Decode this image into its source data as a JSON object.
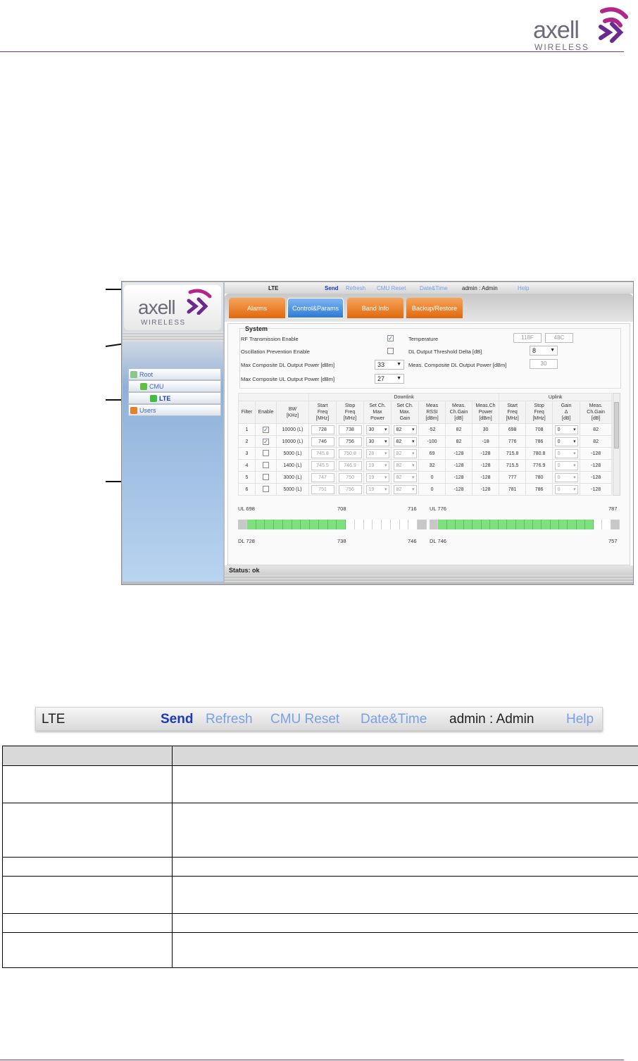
{
  "page": {
    "brand_word": "axell",
    "brand_sub": "WIRELESS",
    "accent_color": "#9a2a6f"
  },
  "screenshot": {
    "topbar": {
      "title": "LTE",
      "send": "Send",
      "refresh": "Refresh",
      "cmu_reset": "CMU Reset",
      "date_time": "Date&Time",
      "user": "admin : Admin",
      "help": "Help"
    },
    "tabs": [
      {
        "label": "Alarms",
        "active": false
      },
      {
        "label": "Control&Params",
        "active": true
      },
      {
        "label": "Band Info",
        "active": false
      },
      {
        "label": "Backup/Restore",
        "active": false
      }
    ],
    "tree": {
      "root": "Root",
      "cmu": "CMU",
      "lte": "LTE",
      "users": "Users"
    },
    "system": {
      "title": "System",
      "rf_enable_label": "RF Transmission Enable",
      "rf_enable_checked": true,
      "osc_label": "Oscillation Prevention Enable",
      "osc_checked": false,
      "max_dl_label": "Max Composite DL Output Power [dBm]",
      "max_dl_value": "33",
      "max_ul_label": "Max Composite UL Output Power [dBm]",
      "max_ul_value": "27",
      "temp_label": "Temperature",
      "temp_f": "118F",
      "temp_c": "48C",
      "dl_thresh_label": "DL Output Threshold Delta [dB]",
      "dl_thresh_value": "8",
      "meas_dl_label": "Meas. Composite DL Output Power [dBm]",
      "meas_dl_value": "30"
    },
    "grid": {
      "group_downlink": "Downlink",
      "group_uplink": "Uplink",
      "headers": {
        "filter": "Filter",
        "enable": "Enable",
        "bw": [
          "BW",
          "[KHz]"
        ],
        "dl_start": [
          "Start",
          "Freq",
          "[MHz]"
        ],
        "dl_stop": [
          "Stop",
          "Freq",
          "[MHz]"
        ],
        "dl_setpow": [
          "Set Ch.",
          "Max",
          "Power"
        ],
        "dl_setgain": [
          "Set Ch.",
          "Max.",
          "Gain"
        ],
        "dl_rssi": [
          "Meas",
          "RSSI",
          "[dBm]"
        ],
        "dl_chgain": [
          "Meas.",
          "Ch.Gain",
          "[dB]"
        ],
        "dl_chpower": [
          "Meas.Ch",
          "Power",
          "[dBm]"
        ],
        "ul_start": [
          "Start",
          "Freq",
          "[MHz]"
        ],
        "ul_stop": [
          "Stop",
          "Freq",
          "[MHz]"
        ],
        "ul_gaindelta": [
          "Gain",
          "Δ",
          "[dB]"
        ],
        "ul_chgain": [
          "Meas.",
          "Ch.Gain",
          "[dB]"
        ]
      },
      "rows": [
        {
          "filter": "1",
          "enabled": true,
          "bw": "10000 (L)",
          "dl_start": "728",
          "dl_stop": "738",
          "dl_pow": "30",
          "dl_gain": "82",
          "rssi": "-52",
          "chgain": "82",
          "chpow": "30",
          "ul_start": "698",
          "ul_stop": "708",
          "ul_gd": "0",
          "ul_chgain": "82"
        },
        {
          "filter": "2",
          "enabled": true,
          "bw": "10000 (L)",
          "dl_start": "746",
          "dl_stop": "756",
          "dl_pow": "30",
          "dl_gain": "82",
          "rssi": "-100",
          "chgain": "82",
          "chpow": "-18",
          "ul_start": "776",
          "ul_stop": "786",
          "ul_gd": "0",
          "ul_chgain": "82"
        },
        {
          "filter": "3",
          "enabled": false,
          "bw": "5000 (L)",
          "dl_start": "745.8",
          "dl_stop": "750.8",
          "dl_pow": "28",
          "dl_gain": "82",
          "rssi": "69",
          "chgain": "-128",
          "chpow": "-128",
          "ul_start": "715.8",
          "ul_stop": "780.8",
          "ul_gd": "0",
          "ul_chgain": "-128"
        },
        {
          "filter": "4",
          "enabled": false,
          "bw": "1400 (L)",
          "dl_start": "745.5",
          "dl_stop": "746.9",
          "dl_pow": "19",
          "dl_gain": "82",
          "rssi": "32",
          "chgain": "-128",
          "chpow": "-128",
          "ul_start": "715.5",
          "ul_stop": "776.9",
          "ul_gd": "0",
          "ul_chgain": "-128"
        },
        {
          "filter": "5",
          "enabled": false,
          "bw": "3000 (L)",
          "dl_start": "747",
          "dl_stop": "750",
          "dl_pow": "19",
          "dl_gain": "82",
          "rssi": "0",
          "chgain": "-128",
          "chpow": "-128",
          "ul_start": "777",
          "ul_stop": "780",
          "ul_gd": "0",
          "ul_chgain": "-128"
        },
        {
          "filter": "6",
          "enabled": false,
          "bw": "5000 (L)",
          "dl_start": "751",
          "dl_stop": "756",
          "dl_pow": "19",
          "dl_gain": "82",
          "rssi": "0",
          "chgain": "-128",
          "chpow": "-128",
          "ul_start": "781",
          "ul_stop": "786",
          "ul_gd": "0",
          "ul_chgain": "-128"
        }
      ]
    },
    "spectrum": {
      "left": {
        "ul_start": "UL 698",
        "ul_mid": "708",
        "ul_end": "716",
        "dl_start": "DL 728",
        "dl_mid": "738",
        "dl_end": "746"
      },
      "right": {
        "ul_start": "UL 776",
        "ul_end": "787",
        "dl_start": "DL 746",
        "dl_end": "757"
      },
      "active_color": "#7fe07f"
    },
    "status": "Status: ok"
  },
  "zoom_toolbar": {
    "title": "LTE",
    "send": "Send",
    "refresh": "Refresh",
    "cmu_reset": "CMU Reset",
    "date_time": "Date&Time",
    "user": "admin : Admin",
    "help": "Help"
  }
}
